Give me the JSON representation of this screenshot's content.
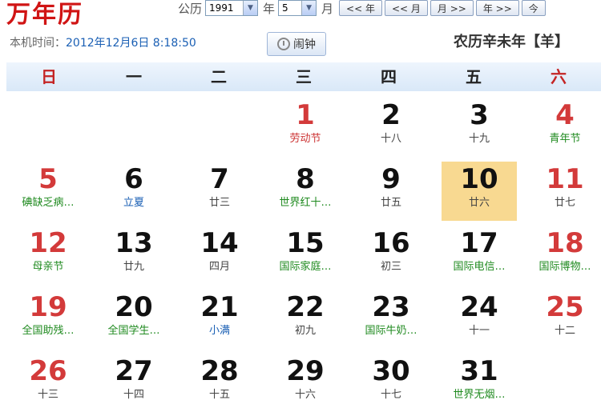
{
  "logo": "万年历",
  "controls": {
    "solar_label": "公历",
    "year_value": "1991",
    "year_unit": "年",
    "month_value": "5",
    "month_unit": "月",
    "buttons": [
      "<< 年",
      "<< 月",
      "月 >>",
      "年 >>",
      "今"
    ]
  },
  "clock": {
    "label": "本机时间：",
    "time": "2012年12月6日 8:18:50"
  },
  "alarm_label": "闹钟",
  "lunar_title": "农历辛未年【羊】",
  "weekdays": [
    "日",
    "一",
    "二",
    "三",
    "四",
    "五",
    "六"
  ],
  "weeks": [
    [
      null,
      null,
      null,
      {
        "day": "1",
        "sub": "劳动节",
        "day_style": "red",
        "sub_style": "red"
      },
      {
        "day": "2",
        "sub": "十八",
        "day_style": "",
        "sub_style": ""
      },
      {
        "day": "3",
        "sub": "十九",
        "day_style": "",
        "sub_style": ""
      },
      {
        "day": "4",
        "sub": "青年节",
        "day_style": "red",
        "sub_style": "green"
      }
    ],
    [
      {
        "day": "5",
        "sub": "碘缺乏病…",
        "day_style": "red",
        "sub_style": "green"
      },
      {
        "day": "6",
        "sub": "立夏",
        "day_style": "",
        "sub_style": "blue"
      },
      {
        "day": "7",
        "sub": "廿三",
        "day_style": "",
        "sub_style": ""
      },
      {
        "day": "8",
        "sub": "世界红十…",
        "day_style": "",
        "sub_style": "green"
      },
      {
        "day": "9",
        "sub": "廿五",
        "day_style": "",
        "sub_style": ""
      },
      {
        "day": "10",
        "sub": "廿六",
        "day_style": "",
        "sub_style": "",
        "today": true
      },
      {
        "day": "11",
        "sub": "廿七",
        "day_style": "red",
        "sub_style": ""
      }
    ],
    [
      {
        "day": "12",
        "sub": "母亲节",
        "day_style": "red",
        "sub_style": "green"
      },
      {
        "day": "13",
        "sub": "廿九",
        "day_style": "",
        "sub_style": ""
      },
      {
        "day": "14",
        "sub": "四月",
        "day_style": "",
        "sub_style": ""
      },
      {
        "day": "15",
        "sub": "国际家庭…",
        "day_style": "",
        "sub_style": "green"
      },
      {
        "day": "16",
        "sub": "初三",
        "day_style": "",
        "sub_style": ""
      },
      {
        "day": "17",
        "sub": "国际电信…",
        "day_style": "",
        "sub_style": "green"
      },
      {
        "day": "18",
        "sub": "国际博物…",
        "day_style": "red",
        "sub_style": "green"
      }
    ],
    [
      {
        "day": "19",
        "sub": "全国助残…",
        "day_style": "red",
        "sub_style": "green"
      },
      {
        "day": "20",
        "sub": "全国学生…",
        "day_style": "",
        "sub_style": "green"
      },
      {
        "day": "21",
        "sub": "小满",
        "day_style": "",
        "sub_style": "blue"
      },
      {
        "day": "22",
        "sub": "初九",
        "day_style": "",
        "sub_style": ""
      },
      {
        "day": "23",
        "sub": "国际牛奶…",
        "day_style": "",
        "sub_style": "green"
      },
      {
        "day": "24",
        "sub": "十一",
        "day_style": "",
        "sub_style": ""
      },
      {
        "day": "25",
        "sub": "十二",
        "day_style": "red",
        "sub_style": ""
      }
    ],
    [
      {
        "day": "26",
        "sub": "十三",
        "day_style": "red",
        "sub_style": ""
      },
      {
        "day": "27",
        "sub": "十四",
        "day_style": "",
        "sub_style": ""
      },
      {
        "day": "28",
        "sub": "十五",
        "day_style": "",
        "sub_style": ""
      },
      {
        "day": "29",
        "sub": "十六",
        "day_style": "",
        "sub_style": ""
      },
      {
        "day": "30",
        "sub": "十七",
        "day_style": "",
        "sub_style": ""
      },
      {
        "day": "31",
        "sub": "世界无烟…",
        "day_style": "",
        "sub_style": "green"
      },
      null
    ]
  ]
}
